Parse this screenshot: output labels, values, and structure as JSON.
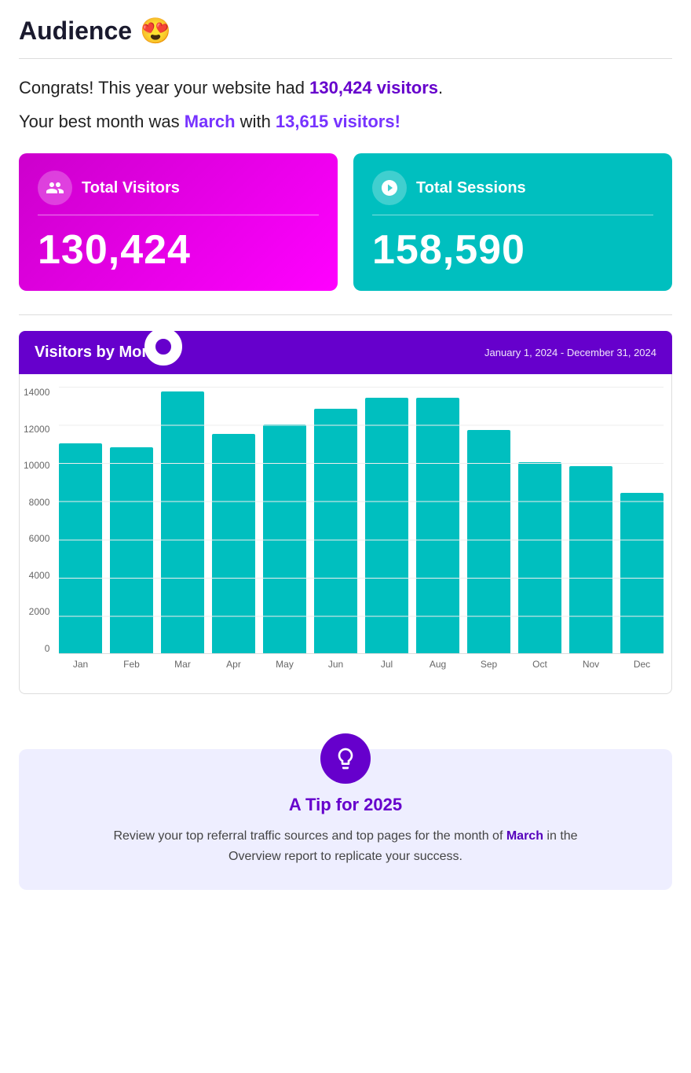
{
  "page": {
    "title": "Audience",
    "title_emoji": "😍"
  },
  "congrats": {
    "line1_prefix": "Congrats! This year your website had ",
    "line1_highlight": "130,424 visitors",
    "line1_suffix": ".",
    "line2_prefix": "Your best month was ",
    "line2_month": "March",
    "line2_middle": " with ",
    "line2_visitors": "13,615 visitors!"
  },
  "cards": {
    "visitors": {
      "label": "Total Visitors",
      "value": "130,424"
    },
    "sessions": {
      "label": "Total Sessions",
      "value": "158,590"
    }
  },
  "chart": {
    "title": "Visitors by Month",
    "date_range": "January 1, 2024 - December 31, 2024",
    "y_labels": [
      "14000",
      "12000",
      "10000",
      "8000",
      "6000",
      "4000",
      "2000",
      "0"
    ],
    "months": [
      "Jan",
      "Feb",
      "Mar",
      "Apr",
      "May",
      "Jun",
      "Jul",
      "Aug",
      "Sep",
      "Oct",
      "Nov",
      "Dec"
    ],
    "values": [
      11000,
      10800,
      13700,
      11500,
      12000,
      12800,
      13400,
      13400,
      11700,
      10000,
      9800,
      8400
    ],
    "max": 14000
  },
  "tip": {
    "title": "A Tip for 2025",
    "text_prefix": "Review your top referral traffic sources and top pages for the month of ",
    "text_highlight": "March",
    "text_suffix": " in the Overview report to replicate your success."
  }
}
